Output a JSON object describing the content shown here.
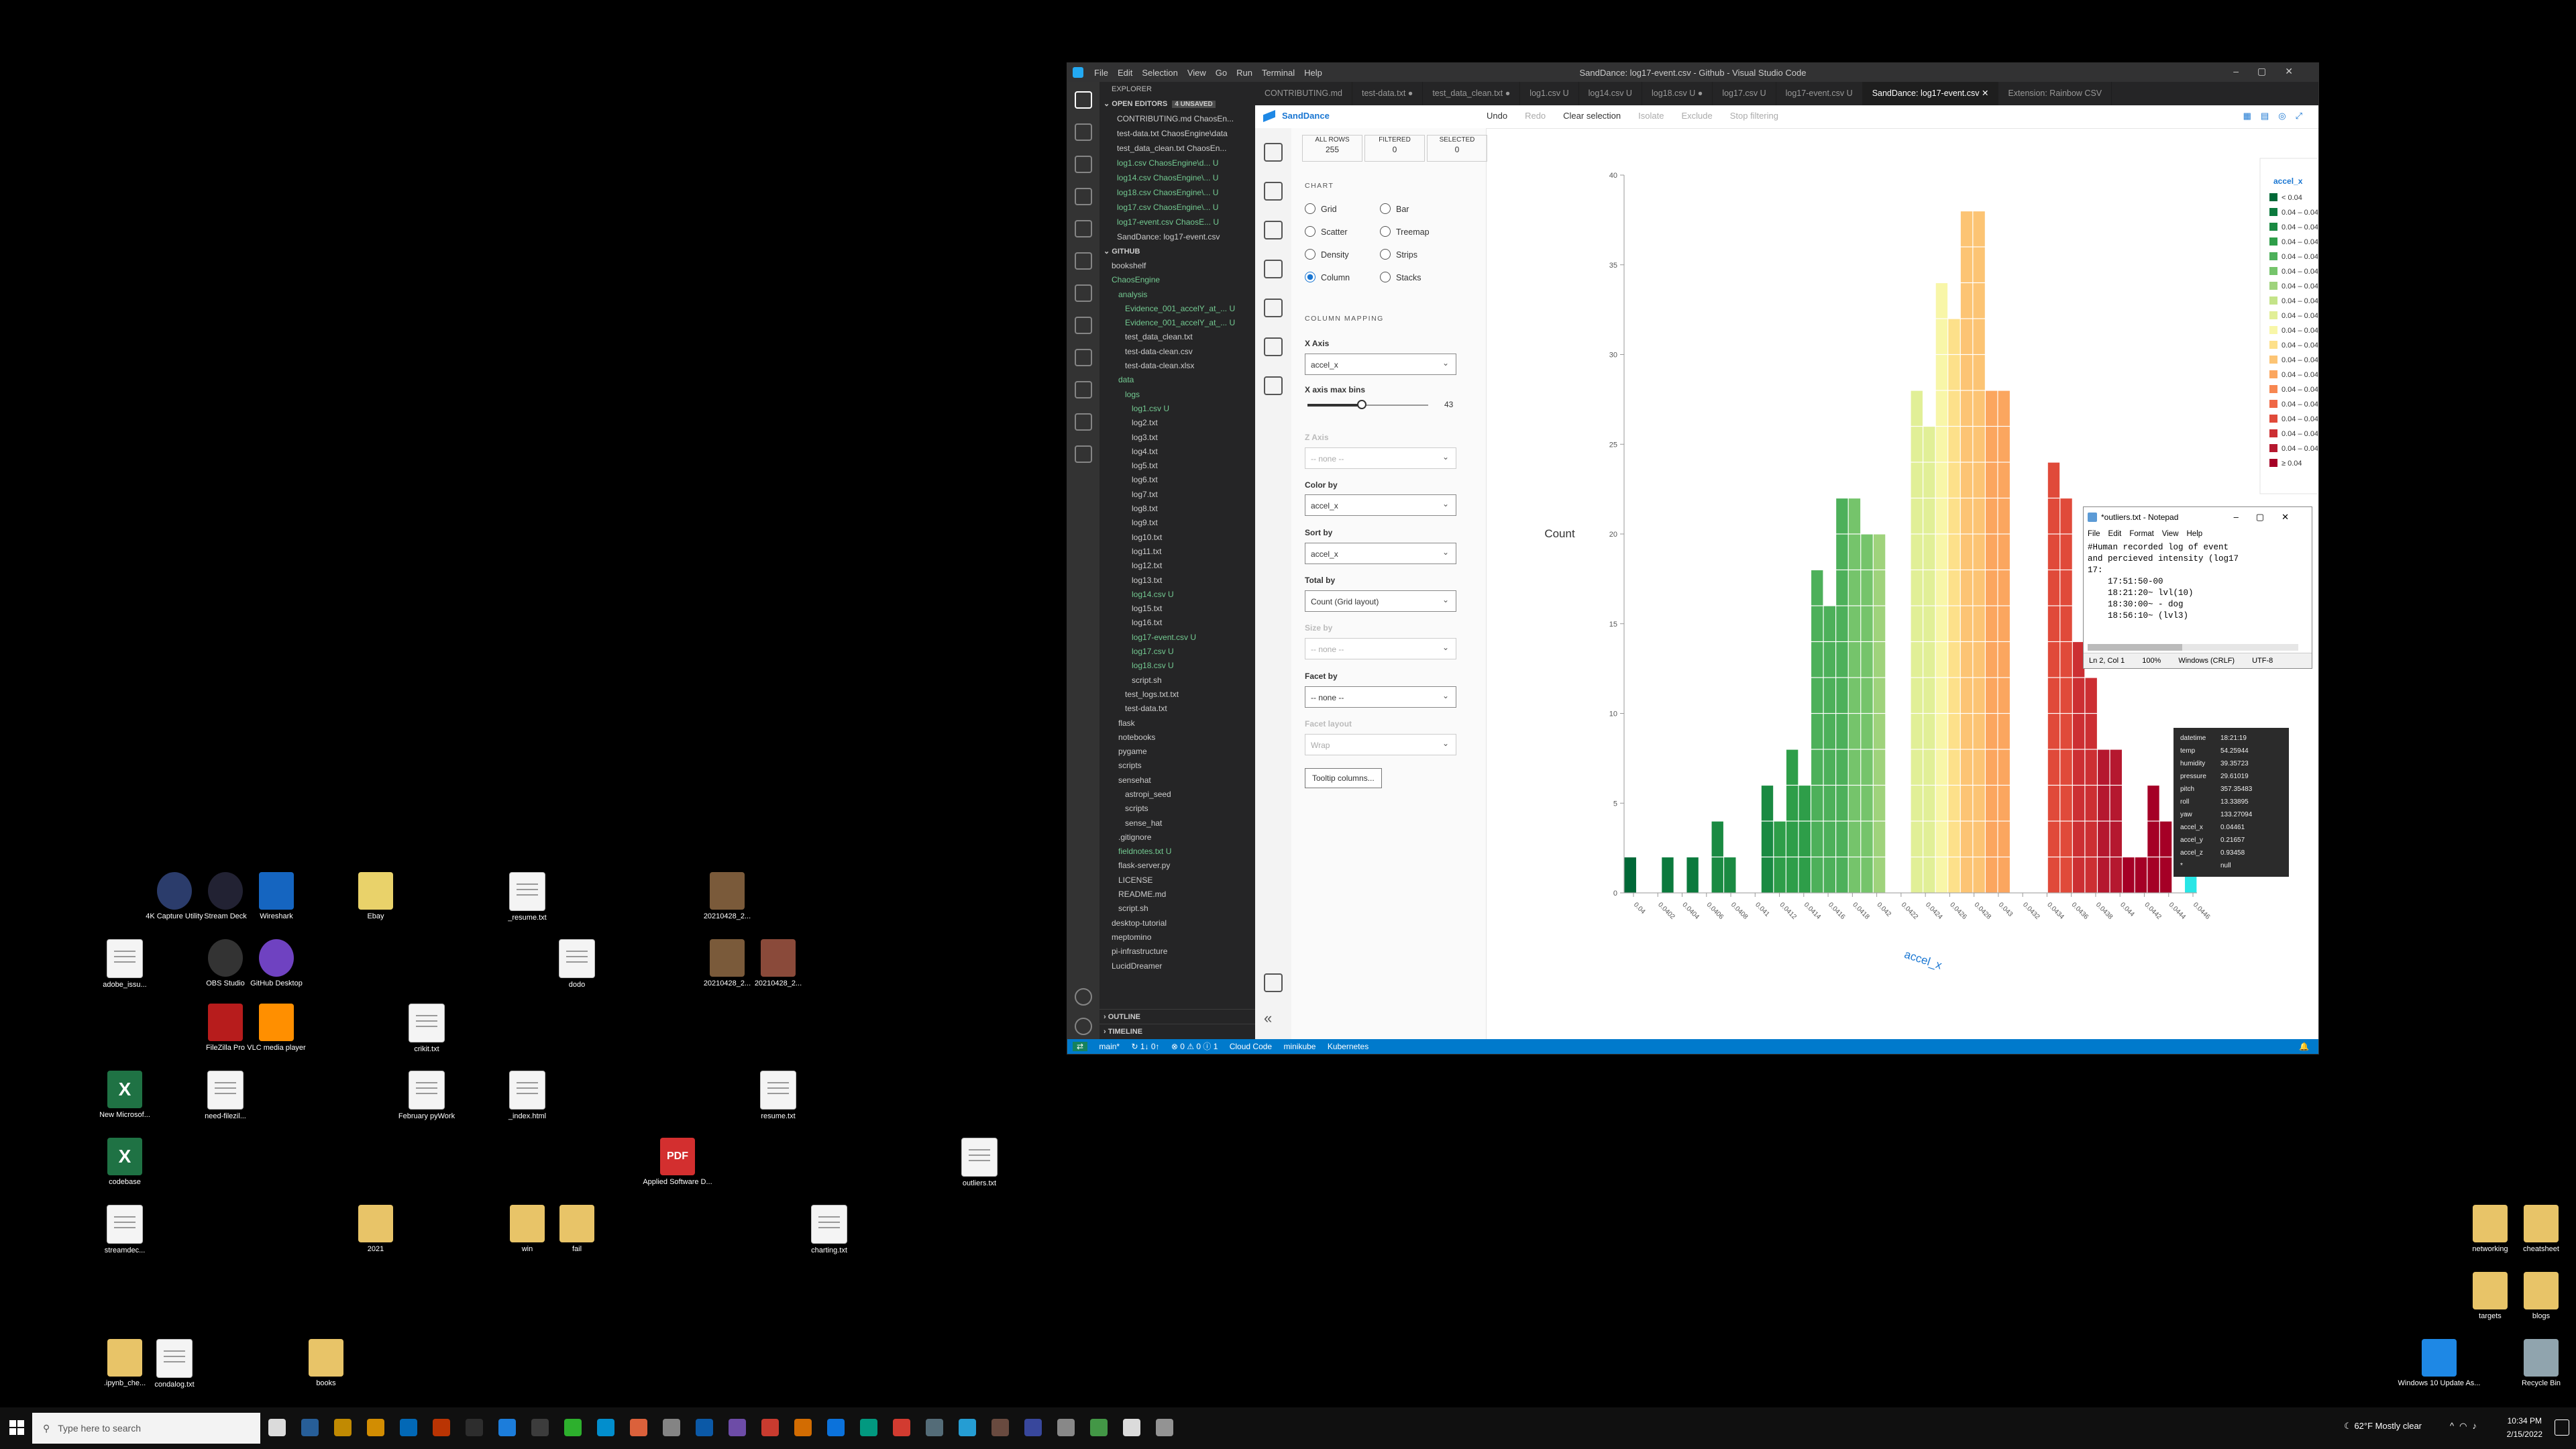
{
  "desktop": {
    "icons_left": [
      {
        "label": "4K Capture Utility",
        "icon": "app-4k-icon",
        "color": "#2b3c6b"
      },
      {
        "label": "Stream Deck",
        "icon": "stream-deck-icon",
        "color": "#223"
      },
      {
        "label": "Wireshark",
        "icon": "wireshark-icon",
        "color": "#1565c0"
      },
      {
        "label": "Ebay",
        "icon": "shortcut-file-icon",
        "color": "#e9d26a"
      },
      {
        "label": "_resume.txt",
        "icon": "text-file-icon",
        "color": "#f4f4f4"
      },
      {
        "label": "20210428_2...",
        "icon": "photo-icon",
        "color": "#7a5a3a"
      },
      {
        "label": "adobe_issu...",
        "icon": "text-file-icon",
        "color": "#f4f4f4"
      },
      {
        "label": "OBS Studio",
        "icon": "obs-icon",
        "color": "#333"
      },
      {
        "label": "GitHub Desktop",
        "icon": "github-icon",
        "color": "#6f42c1"
      },
      {
        "label": "dodo",
        "icon": "file-icon",
        "color": "#f4f4f4"
      },
      {
        "label": "20210428_2...",
        "icon": "photo-icon",
        "color": "#7a5a3a"
      },
      {
        "label": "20210428_2...",
        "icon": "photo-icon",
        "color": "#8a4a3a"
      },
      {
        "label": "FileZilla Pro",
        "icon": "filezilla-icon",
        "color": "#b71c1c"
      },
      {
        "label": "VLC media player",
        "icon": "vlc-icon",
        "color": "#ff8f00"
      },
      {
        "label": "crikit.txt",
        "icon": "text-file-icon",
        "color": "#f4f4f4"
      },
      {
        "label": "New Microsof...",
        "icon": "excel-icon",
        "color": "#1f7244"
      },
      {
        "label": "need-filezil...",
        "icon": "text-file-icon",
        "color": "#f4f4f4"
      },
      {
        "label": "February pyWork",
        "icon": "text-file-icon",
        "color": "#f4f4f4"
      },
      {
        "label": "_index.html",
        "icon": "text-file-icon",
        "color": "#f4f4f4"
      },
      {
        "label": "resume.txt",
        "icon": "text-file-icon",
        "color": "#f4f4f4"
      },
      {
        "label": "codebase",
        "icon": "excel-icon",
        "color": "#1f7244"
      },
      {
        "label": "Applied Software D...",
        "icon": "pdf-icon",
        "color": "#d32f2f"
      },
      {
        "label": "outliers.txt",
        "icon": "text-file-icon",
        "color": "#f4f4f4"
      },
      {
        "label": "streamdec...",
        "icon": "text-file-icon",
        "color": "#f4f4f4"
      },
      {
        "label": "2021",
        "icon": "zip-folder-icon",
        "color": "#e8c468"
      },
      {
        "label": "win",
        "icon": "folder-icon",
        "color": "#e8c468"
      },
      {
        "label": "fail",
        "icon": "folder-icon",
        "color": "#e8c468"
      },
      {
        "label": "charting.txt",
        "icon": "text-file-icon",
        "color": "#f4f4f4"
      },
      {
        "label": ".ipynb_che...",
        "icon": "folder-icon",
        "color": "#e8c468"
      },
      {
        "label": "condalog.txt",
        "icon": "text-file-icon",
        "color": "#f4f4f4"
      },
      {
        "label": "books",
        "icon": "folder-icon",
        "color": "#e8c468"
      }
    ],
    "icons_right": [
      {
        "label": "networking",
        "icon": "folder-icon",
        "color": "#e8c468"
      },
      {
        "label": "cheatsheet",
        "icon": "folder-icon",
        "color": "#e8c468"
      },
      {
        "label": "targets",
        "icon": "file-icon",
        "color": "#e8c468"
      },
      {
        "label": "blogs",
        "icon": "folder-icon",
        "color": "#e8c468"
      },
      {
        "label": "Windows 10 Update As...",
        "icon": "windows-icon",
        "color": "#1e88e5"
      },
      {
        "label": "Recycle Bin",
        "icon": "recycle-bin-icon",
        "color": "#90a4ae"
      }
    ]
  },
  "vscode": {
    "window_title": "SandDance: log17-event.csv - Github - Visual Studio Code",
    "menu": [
      "File",
      "Edit",
      "Selection",
      "View",
      "Go",
      "Run",
      "Terminal",
      "Help"
    ],
    "tabs": [
      {
        "label": "CONTRIBUTING.md",
        "active": false
      },
      {
        "label": "test-data.txt ●",
        "active": false
      },
      {
        "label": "test_data_clean.txt ●",
        "active": false
      },
      {
        "label": "log1.csv U",
        "active": false
      },
      {
        "label": "log14.csv U",
        "active": false
      },
      {
        "label": "log18.csv U ●",
        "active": false
      },
      {
        "label": "log17.csv U",
        "active": false
      },
      {
        "label": "log17-event.csv U",
        "active": false
      },
      {
        "label": "SandDance: log17-event.csv ✕",
        "active": true
      },
      {
        "label": "Extension: Rainbow CSV",
        "active": false
      }
    ],
    "sidebar": {
      "title": "EXPLORER",
      "open_editors_label": "OPEN EDITORS",
      "unsaved_badge": "4 UNSAVED",
      "open_editors": [
        {
          "label": "CONTRIBUTING.md ChaosEn...",
          "color": "#cccccc"
        },
        {
          "label": "test-data.txt ChaosEngine\\data",
          "color": "#cccccc"
        },
        {
          "label": "test_data_clean.txt ChaosEn...",
          "color": "#cccccc"
        },
        {
          "label": "log1.csv ChaosEngine\\d...  U",
          "color": "#73c991"
        },
        {
          "label": "log14.csv ChaosEngine\\...  U",
          "color": "#73c991"
        },
        {
          "label": "log18.csv ChaosEngine\\...  U",
          "color": "#73c991"
        },
        {
          "label": "log17.csv ChaosEngine\\...  U",
          "color": "#73c991"
        },
        {
          "label": "log17-event.csv ChaosE...  U",
          "color": "#73c991"
        },
        {
          "label": "SandDance: log17-event.csv",
          "color": "#cccccc"
        }
      ],
      "workspace_label": "GITHUB",
      "tree": [
        {
          "label": "bookshelf",
          "color": "#cccccc",
          "indent": 1
        },
        {
          "label": "ChaosEngine",
          "color": "#73c991",
          "indent": 1
        },
        {
          "label": "analysis",
          "color": "#73c991",
          "indent": 2
        },
        {
          "label": "Evidence_001_accelY_at_...  U",
          "color": "#73c991",
          "indent": 3
        },
        {
          "label": "Evidence_001_accelY_at_...  U",
          "color": "#73c991",
          "indent": 3
        },
        {
          "label": "test_data_clean.txt",
          "color": "#cccccc",
          "indent": 3
        },
        {
          "label": "test-data-clean.csv",
          "color": "#cccccc",
          "indent": 3
        },
        {
          "label": "test-data-clean.xlsx",
          "color": "#cccccc",
          "indent": 3
        },
        {
          "label": "data",
          "color": "#73c991",
          "indent": 2
        },
        {
          "label": "logs",
          "color": "#73c991",
          "indent": 3
        },
        {
          "label": "log1.csv  U",
          "color": "#73c991",
          "indent": 4
        },
        {
          "label": "log2.txt",
          "color": "#cccccc",
          "indent": 4
        },
        {
          "label": "log3.txt",
          "color": "#cccccc",
          "indent": 4
        },
        {
          "label": "log4.txt",
          "color": "#cccccc",
          "indent": 4
        },
        {
          "label": "log5.txt",
          "color": "#cccccc",
          "indent": 4
        },
        {
          "label": "log6.txt",
          "color": "#cccccc",
          "indent": 4
        },
        {
          "label": "log7.txt",
          "color": "#cccccc",
          "indent": 4
        },
        {
          "label": "log8.txt",
          "color": "#cccccc",
          "indent": 4
        },
        {
          "label": "log9.txt",
          "color": "#cccccc",
          "indent": 4
        },
        {
          "label": "log10.txt",
          "color": "#cccccc",
          "indent": 4
        },
        {
          "label": "log11.txt",
          "color": "#cccccc",
          "indent": 4
        },
        {
          "label": "log12.txt",
          "color": "#cccccc",
          "indent": 4
        },
        {
          "label": "log13.txt",
          "color": "#cccccc",
          "indent": 4
        },
        {
          "label": "log14.csv  U",
          "color": "#73c991",
          "indent": 4
        },
        {
          "label": "log15.txt",
          "color": "#cccccc",
          "indent": 4
        },
        {
          "label": "log16.txt",
          "color": "#cccccc",
          "indent": 4
        },
        {
          "label": "log17-event.csv  U",
          "color": "#73c991",
          "indent": 4
        },
        {
          "label": "log17.csv  U",
          "color": "#73c991",
          "indent": 4
        },
        {
          "label": "log18.csv  U",
          "color": "#73c991",
          "indent": 4
        },
        {
          "label": "script.sh",
          "color": "#cccccc",
          "indent": 4
        },
        {
          "label": "test_logs.txt.txt",
          "color": "#cccccc",
          "indent": 3
        },
        {
          "label": "test-data.txt",
          "color": "#cccccc",
          "indent": 3
        },
        {
          "label": "flask",
          "color": "#cccccc",
          "indent": 2
        },
        {
          "label": "notebooks",
          "color": "#cccccc",
          "indent": 2
        },
        {
          "label": "pygame",
          "color": "#cccccc",
          "indent": 2
        },
        {
          "label": "scripts",
          "color": "#cccccc",
          "indent": 2
        },
        {
          "label": "sensehat",
          "color": "#cccccc",
          "indent": 2
        },
        {
          "label": "astropi_seed",
          "color": "#cccccc",
          "indent": 3
        },
        {
          "label": "scripts",
          "color": "#cccccc",
          "indent": 3
        },
        {
          "label": "sense_hat",
          "color": "#cccccc",
          "indent": 3
        },
        {
          "label": ".gitignore",
          "color": "#cccccc",
          "indent": 2
        },
        {
          "label": "fieldnotes.txt  U",
          "color": "#73c991",
          "indent": 2
        },
        {
          "label": "flask-server.py",
          "color": "#cccccc",
          "indent": 2
        },
        {
          "label": "LICENSE",
          "color": "#cccccc",
          "indent": 2
        },
        {
          "label": "README.md",
          "color": "#cccccc",
          "indent": 2
        },
        {
          "label": "script.sh",
          "color": "#cccccc",
          "indent": 2
        },
        {
          "label": "desktop-tutorial",
          "color": "#cccccc",
          "indent": 1
        },
        {
          "label": "meptomino",
          "color": "#cccccc",
          "indent": 1
        },
        {
          "label": "pi-infrastructure",
          "color": "#cccccc",
          "indent": 1
        },
        {
          "label": "LucidDreamer",
          "color": "#cccccc",
          "indent": 1
        }
      ],
      "outline_label": "OUTLINE",
      "timeline_label": "TIMELINE"
    },
    "status": {
      "branch": "main*",
      "sync": "↻ 1↓ 0↑",
      "problems": "⊗ 0 ⚠ 0 ⓘ 1",
      "cloud_code": "Cloud Code",
      "minikube": "minikube",
      "kubernetes": "Kubernetes"
    }
  },
  "sanddance": {
    "title": "SandDance",
    "toolbar": [
      "Undo",
      "Redo",
      "Clear selection",
      "Isolate",
      "Exclude",
      "Stop filtering"
    ],
    "counts": [
      {
        "label": "ALL ROWS",
        "value": "255"
      },
      {
        "label": "FILTERED",
        "value": "0"
      },
      {
        "label": "SELECTED",
        "value": "0"
      }
    ],
    "chart_section": "CHART",
    "chart_types": [
      {
        "label": "Grid",
        "on": false
      },
      {
        "label": "Bar",
        "on": false
      },
      {
        "label": "Scatter",
        "on": false
      },
      {
        "label": "Treemap",
        "on": false
      },
      {
        "label": "Density",
        "on": false
      },
      {
        "label": "Strips",
        "on": false
      },
      {
        "label": "Column",
        "on": true
      },
      {
        "label": "Stacks",
        "on": false
      }
    ],
    "mapping_section": "COLUMN MAPPING",
    "fields": {
      "x_axis_label": "X Axis",
      "x_axis_value": "accel_x",
      "bins_label": "X axis max bins",
      "bins_value": "43",
      "bins_fraction": 0.45,
      "z_axis_label": "Z Axis",
      "z_axis_value": "-- none --",
      "color_by_label": "Color by",
      "color_by_value": "accel_x",
      "sort_by_label": "Sort by",
      "sort_by_value": "accel_x",
      "total_by_label": "Total by",
      "total_by_value": "Count (Grid layout)",
      "size_by_label": "Size by",
      "size_by_value": "-- none --",
      "facet_by_label": "Facet by",
      "facet_by_value": "-- none --",
      "facet_layout_label": "Facet layout",
      "facet_layout_value": "Wrap",
      "tooltip_button": "Tooltip columns..."
    }
  },
  "chart_data": {
    "type": "bar",
    "xlabel": "accel_x",
    "ylabel": "Count",
    "ylim": [
      0,
      40
    ],
    "yticks": [
      0,
      5,
      10,
      15,
      20,
      25,
      30,
      35,
      40
    ],
    "grid": false,
    "legend_position": "top-right",
    "legend_title": "accel_x",
    "legend_items": [
      "< 0.04",
      "0.04 – 0.04",
      "0.04 – 0.04",
      "0.04 – 0.04",
      "0.04 – 0.04",
      "0.04 – 0.04",
      "0.04 – 0.04",
      "0.04 – 0.04",
      "0.04 – 0.04",
      "0.04 – 0.04",
      "0.04 – 0.04",
      "0.04 – 0.04",
      "0.04 – 0.04",
      "0.04 – 0.04",
      "0.04 – 0.04",
      "0.04 – 0.04",
      "0.04 – 0.04",
      "0.04 – 0.04",
      "≥ 0.04"
    ],
    "legend_colors": [
      "#006837",
      "#0b7a3d",
      "#1a8a42",
      "#2e9e49",
      "#4db05a",
      "#75c46b",
      "#9fd37c",
      "#c4e389",
      "#e1ef97",
      "#f8f6a8",
      "#fde08a",
      "#fcc474",
      "#fba65f",
      "#f78751",
      "#ef6745",
      "#e04a3a",
      "#cc2f33",
      "#b5182f",
      "#a50026"
    ],
    "x_tick_labels": [
      "0.04",
      "0.0402",
      "0.0404",
      "0.0406",
      "0.0408",
      "0.041",
      "0.0412",
      "0.0414",
      "0.0416",
      "0.0418",
      "0.042",
      "0.0422",
      "0.0424",
      "0.0426",
      "0.0428",
      "0.043",
      "0.0432",
      "0.0434",
      "0.0436",
      "0.0438",
      "0.044",
      "0.0442",
      "0.0444",
      "0.0446"
    ],
    "values": [
      2,
      0,
      0,
      2,
      0,
      2,
      0,
      4,
      2,
      0,
      0,
      6,
      4,
      8,
      6,
      18,
      16,
      22,
      22,
      20,
      20,
      0,
      0,
      28,
      26,
      34,
      32,
      38,
      38,
      28,
      28,
      0,
      0,
      0,
      24,
      22,
      14,
      12,
      8,
      8,
      2,
      2,
      6,
      4,
      0,
      2
    ],
    "colors": [
      "#006837",
      "#006837",
      "#006837",
      "#0b7a3d",
      "#0b7a3d",
      "#0b7a3d",
      "#0b7a3d",
      "#1a8a42",
      "#1a8a42",
      "#1a8a42",
      "#1a8a42",
      "#1a8a42",
      "#2e9e49",
      "#2e9e49",
      "#2e9e49",
      "#4db05a",
      "#4db05a",
      "#4db05a",
      "#75c46b",
      "#75c46b",
      "#9fd37c",
      "#c4e389",
      "#c4e389",
      "#e1ef97",
      "#e1ef97",
      "#f8f6a8",
      "#fde08a",
      "#fcc474",
      "#fcc474",
      "#fba65f",
      "#fba65f",
      "#f78751",
      "#f78751",
      "#ef6745",
      "#e04a3a",
      "#e04a3a",
      "#cc2f33",
      "#cc2f33",
      "#b5182f",
      "#b5182f",
      "#a50026",
      "#a50026",
      "#a50026",
      "#a50026",
      "#a50026",
      "#29e6e6"
    ]
  },
  "tooltip": [
    {
      "k": "datetime",
      "v": "18:21:19"
    },
    {
      "k": "temp",
      "v": "54.25944"
    },
    {
      "k": "humidity",
      "v": "39.35723"
    },
    {
      "k": "pressure",
      "v": "29.61019"
    },
    {
      "k": "pitch",
      "v": "357.35483"
    },
    {
      "k": "roll",
      "v": "13.33895"
    },
    {
      "k": "yaw",
      "v": "133.27094"
    },
    {
      "k": "accel_x",
      "v": "0.04461"
    },
    {
      "k": "accel_y",
      "v": "0.21657"
    },
    {
      "k": "accel_z",
      "v": "0.93458"
    },
    {
      "k": "*",
      "v": "null"
    }
  ],
  "notepad": {
    "title": "*outliers.txt - Notepad",
    "menu": [
      "File",
      "Edit",
      "Format",
      "View",
      "Help"
    ],
    "content": "#Human recorded log of event\nand percieved intensity (log17\n17:\n    17:51:50-00\n    18:21:20~ lvl(10)\n    18:30:00~ - dog\n    18:56:10~ (lvl3)",
    "status_pos": "Ln 2, Col 1",
    "status_zoom": "100%",
    "status_eol": "Windows (CRLF)",
    "status_enc": "UTF-8"
  },
  "taskbar": {
    "search_placeholder": "Type here to search",
    "weather": "62°F  Mostly clear",
    "time": "10:34 PM",
    "date": "2/15/2022"
  }
}
